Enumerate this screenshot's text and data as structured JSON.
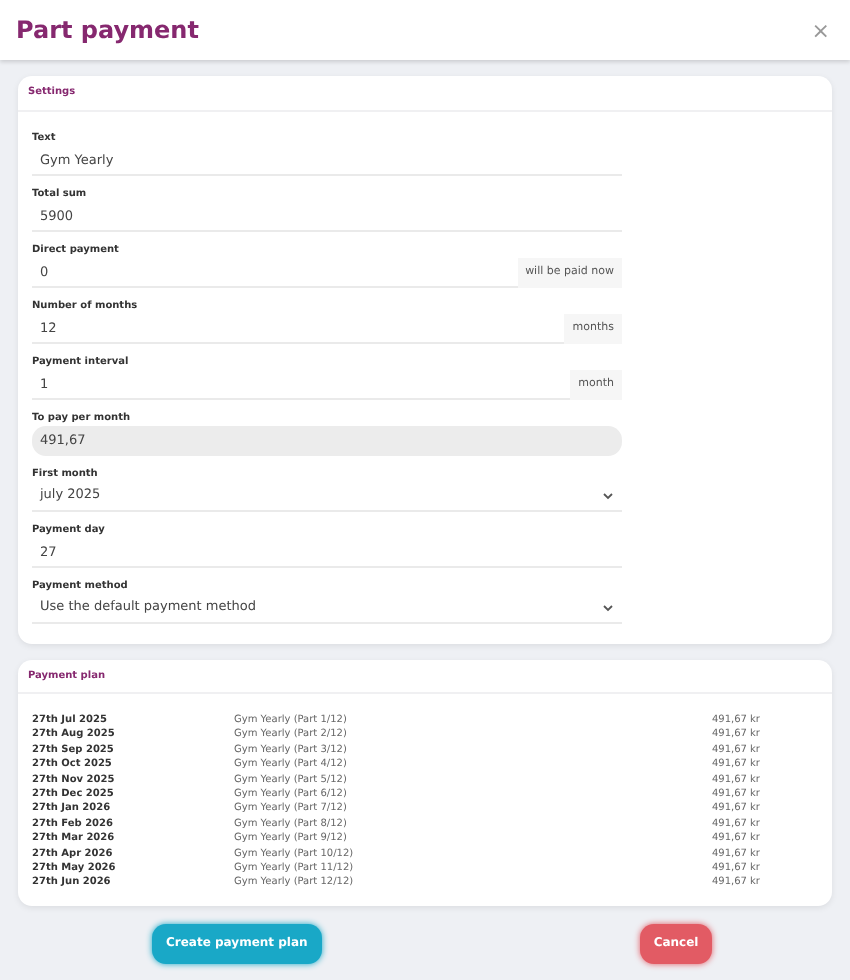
{
  "dialog": {
    "title": "Part payment",
    "close": "×"
  },
  "settings": {
    "title": "Settings",
    "fields": [
      {
        "kind": "text",
        "label": "Text",
        "value": "Gym Yearly"
      },
      {
        "kind": "text",
        "label": "Total sum",
        "value": "5900"
      },
      {
        "kind": "addon",
        "label": "Direct payment",
        "value": "0",
        "addon": "will be paid now"
      },
      {
        "kind": "addon",
        "label": "Number of months",
        "value": "12",
        "addon": "months"
      },
      {
        "kind": "addon",
        "label": "Payment interval",
        "value": "1",
        "addon": "month"
      },
      {
        "kind": "readonly",
        "label": "To pay per month",
        "value": "491,67"
      },
      {
        "kind": "select",
        "label": "First month",
        "value": "july 2025"
      },
      {
        "kind": "text",
        "label": "Payment day",
        "value": "27"
      },
      {
        "kind": "select",
        "label": "Payment method",
        "value": "Use the default payment method"
      }
    ]
  },
  "plan": {
    "title": "Payment plan",
    "rows": [
      {
        "date": "27th Jul 2025",
        "text": "Gym Yearly (Part 1/12)",
        "amount": "491,67 kr"
      },
      {
        "date": "27th Aug 2025",
        "text": "Gym Yearly (Part 2/12)",
        "amount": "491,67 kr"
      },
      {
        "date": "27th Sep 2025",
        "text": "Gym Yearly (Part 3/12)",
        "amount": "491,67 kr"
      },
      {
        "date": "27th Oct 2025",
        "text": "Gym Yearly (Part 4/12)",
        "amount": "491,67 kr"
      },
      {
        "date": "27th Nov 2025",
        "text": "Gym Yearly (Part 5/12)",
        "amount": "491,67 kr"
      },
      {
        "date": "27th Dec 2025",
        "text": "Gym Yearly (Part 6/12)",
        "amount": "491,67 kr"
      },
      {
        "date": "27th Jan 2026",
        "text": "Gym Yearly (Part 7/12)",
        "amount": "491,67 kr"
      },
      {
        "date": "27th Feb 2026",
        "text": "Gym Yearly (Part 8/12)",
        "amount": "491,67 kr"
      },
      {
        "date": "27th Mar 2026",
        "text": "Gym Yearly (Part 9/12)",
        "amount": "491,67 kr"
      },
      {
        "date": "27th Apr 2026",
        "text": "Gym Yearly (Part 10/12)",
        "amount": "491,67 kr"
      },
      {
        "date": "27th May 2026",
        "text": "Gym Yearly (Part 11/12)",
        "amount": "491,67 kr"
      },
      {
        "date": "27th Jun 2026",
        "text": "Gym Yearly (Part 12/12)",
        "amount": "491,67 kr"
      }
    ]
  },
  "buttons": [
    {
      "kind": "primary",
      "label": "Create payment plan"
    },
    {
      "kind": "danger",
      "label": "Cancel"
    }
  ]
}
